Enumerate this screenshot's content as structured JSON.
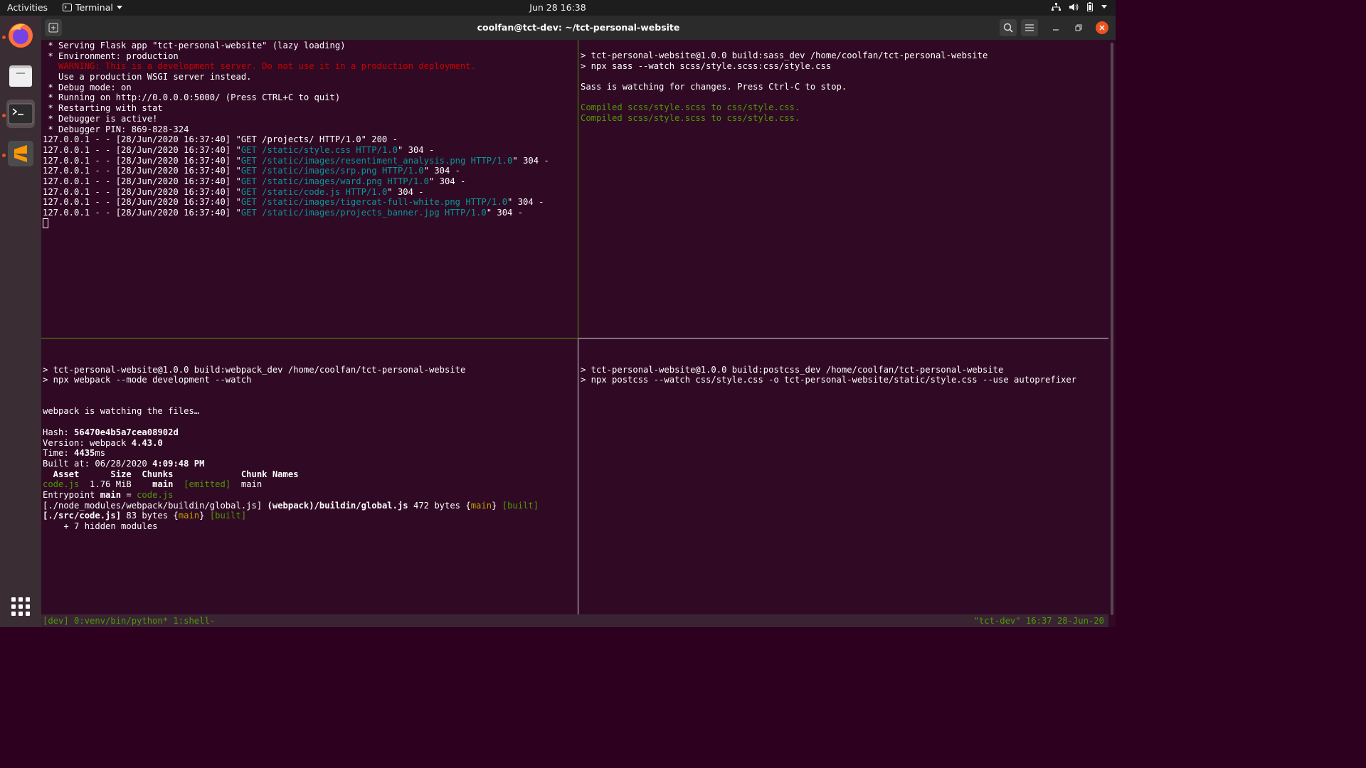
{
  "topbar": {
    "activities": "Activities",
    "app_name": "Terminal",
    "clock": "Jun 28  16:38",
    "tray_icons": [
      "network-icon",
      "volume-icon",
      "battery-icon",
      "chevron-down-icon"
    ]
  },
  "dock": {
    "items": [
      "firefox-icon",
      "files-icon",
      "terminal-icon",
      "sublime-text-icon"
    ],
    "show_apps": "app-grid-icon"
  },
  "window": {
    "title": "coolfan@tct-dev: ~/tct-personal-website"
  },
  "panes": {
    "top_left": {
      "lines": [
        " * Serving Flask app \"tct-personal-website\" (lazy loading)",
        " * Environment: production",
        "   WARNING: This is a development server. Do not use it in a production deployment.",
        "   Use a production WSGI server instead.",
        " * Debug mode: on",
        " * Running on http://0.0.0.0:5000/ (Press CTRL+C to quit)",
        " * Restarting with stat",
        " * Debugger is active!",
        " * Debugger PIN: 869-828-324",
        "127.0.0.1 - - [28/Jun/2020 16:37:40] \"GET /projects/ HTTP/1.0\" 200 -"
      ],
      "requests": [
        {
          "prefix": "127.0.0.1 - - [28/Jun/2020 16:37:40] \"",
          "req": "GET /static/style.css HTTP/1.0",
          "suffix": "\" 304 -"
        },
        {
          "prefix": "127.0.0.1 - - [28/Jun/2020 16:37:40] \"",
          "req": "GET /static/images/resentiment_analysis.png HTTP/1.0",
          "suffix": "\" 304 -"
        },
        {
          "prefix": "127.0.0.1 - - [28/Jun/2020 16:37:40] \"",
          "req": "GET /static/images/srp.png HTTP/1.0",
          "suffix": "\" 304 -"
        },
        {
          "prefix": "127.0.0.1 - - [28/Jun/2020 16:37:40] \"",
          "req": "GET /static/images/ward.png HTTP/1.0",
          "suffix": "\" 304 -"
        },
        {
          "prefix": "127.0.0.1 - - [28/Jun/2020 16:37:40] \"",
          "req": "GET /static/code.js HTTP/1.0",
          "suffix": "\" 304 -"
        },
        {
          "prefix": "127.0.0.1 - - [28/Jun/2020 16:37:40] \"",
          "req": "GET /static/images/tigercat-full-white.png HTTP/1.0",
          "suffix": "\" 304 -"
        },
        {
          "prefix": "127.0.0.1 - - [28/Jun/2020 16:37:40] \"",
          "req": "GET /static/images/projects_banner.jpg HTTP/1.0",
          "suffix": "\" 304 -"
        }
      ]
    },
    "top_right": {
      "lines": [
        "> tct-personal-website@1.0.0 build:sass_dev /home/coolfan/tct-personal-website",
        "> npx sass --watch scss/style.scss:css/style.css",
        "",
        "Sass is watching for changes. Press Ctrl-C to stop.",
        "",
        "Compiled scss/style.scss to css/style.css.",
        "Compiled scss/style.scss to css/style.css."
      ]
    },
    "bottom_left": {
      "cmd1": "> tct-personal-website@1.0.0 build:webpack_dev /home/coolfan/tct-personal-website",
      "cmd2": "> npx webpack --mode development --watch",
      "watching": "webpack is watching the files…",
      "hash_label": "Hash: ",
      "hash": "56470e4b5a7cea08902d",
      "version_label": "Version: webpack ",
      "version": "4.43.0",
      "time_label": "Time: ",
      "time": "4435",
      "time_unit": "ms",
      "built_label": "Built at: 06/28/2020 ",
      "built_time": "4:09:48 PM",
      "table_header": "  Asset      Size  Chunks             Chunk Names",
      "asset": "code.js",
      "asset_size": "  1.76 MiB    ",
      "asset_chunk": "main",
      "asset_emitted": "  [emitted]",
      "asset_name": "  main",
      "entry_label": "Entrypoint ",
      "entry_main": "main",
      "entry_eq": " = ",
      "entry_file": "code.js",
      "mod1_path": "[./node_modules/webpack/buildin/global.js] ",
      "mod1_name": "(webpack)/buildin/global.js",
      "mod1_size": " 472 bytes {",
      "mod1_chunk": "main",
      "mod1_close": "} ",
      "mod1_built": "[built]",
      "mod2_path": "[./src/code.js]",
      "mod2_size": " 83 bytes {",
      "mod2_chunk": "main",
      "mod2_close": "} ",
      "mod2_built": "[built]",
      "hidden": "    + 7 hidden modules"
    },
    "bottom_right": {
      "lines": [
        "> tct-personal-website@1.0.0 build:postcss_dev /home/coolfan/tct-personal-website",
        "> npx postcss --watch css/style.css -o tct-personal-website/static/style.css --use autoprefixer"
      ]
    }
  },
  "tmux_status": {
    "left": "[dev] 0:venv/bin/python* 1:shell-",
    "right": "\"tct-dev\" 16:37 28-Jun-20"
  },
  "colors": {
    "terminal_bg": "#300a24",
    "accent": "#e95420",
    "active_pane_border": "#4e9a06"
  }
}
